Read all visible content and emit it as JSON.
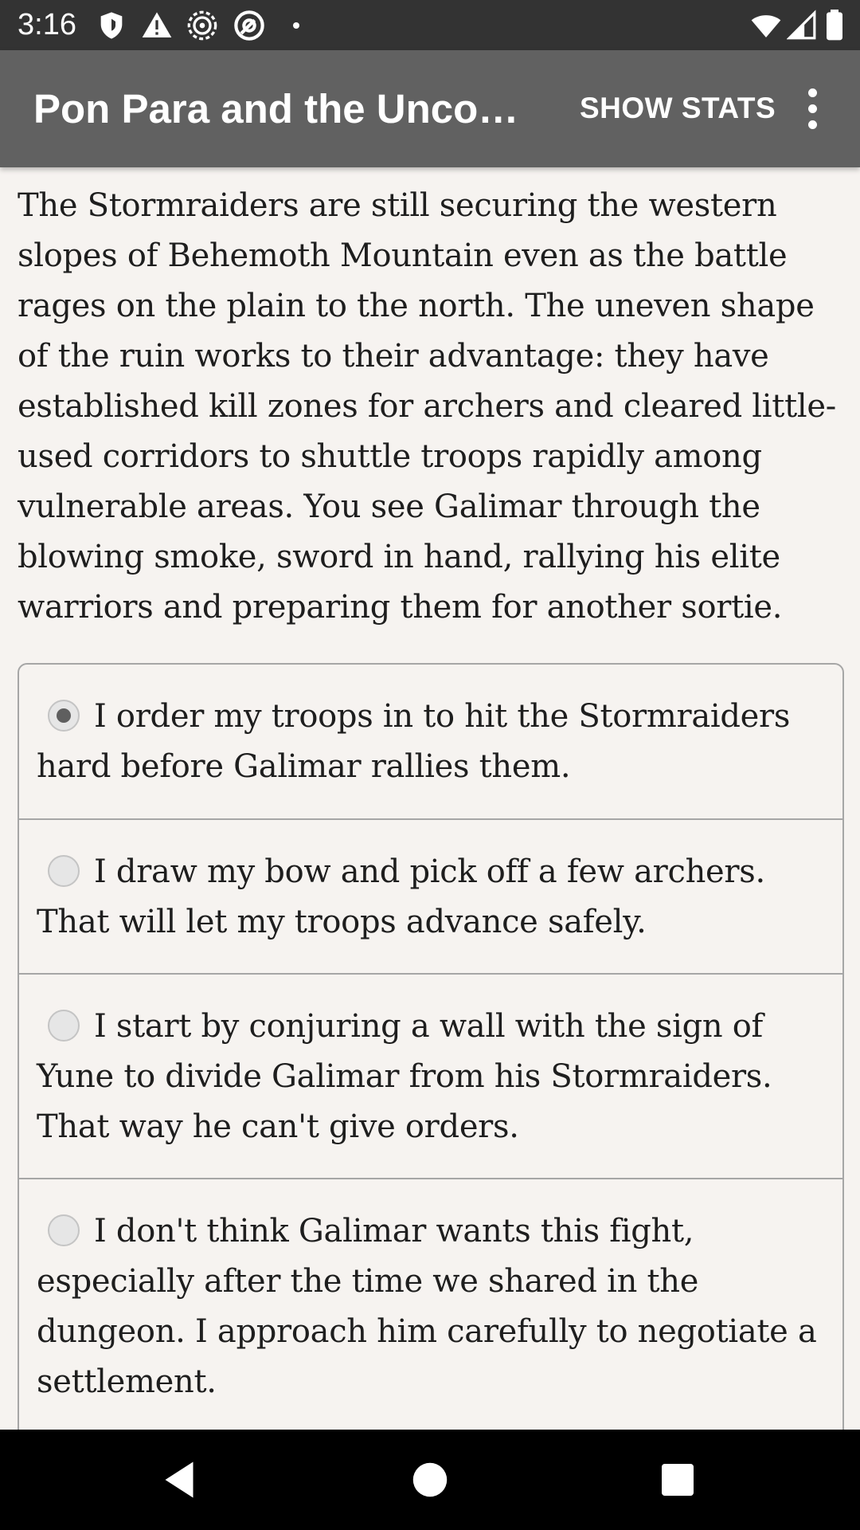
{
  "status_bar": {
    "time": "3:16",
    "icons": [
      "shield-icon",
      "warning-icon",
      "settings-badge-icon",
      "at-sign-icon",
      "dot-icon",
      "wifi-icon",
      "signal-icon",
      "battery-icon"
    ]
  },
  "app_bar": {
    "title": "Pon Para and the Unconquered Kings",
    "show_stats_label": "SHOW STATS",
    "menu_icon": "more-vert-icon",
    "background": "#616161"
  },
  "story": {
    "text": "The Stormraiders are still securing the western slopes of Behemoth Mountain even as the battle rages on the plain to the north. The uneven shape of the ruin works to their advantage: they have established kill zones for archers and cleared little-used corridors to shuttle troops rapidly among vulnerable areas. You see Galimar through the blowing smoke, sword in hand, rallying his elite warriors and preparing them for another sortie."
  },
  "choices": [
    {
      "label": "I order my troops in to hit the Stormraiders hard before Galimar rallies them.",
      "selected": true
    },
    {
      "label": "I draw my bow and pick off a few archers. That will let my troops advance safely.",
      "selected": false
    },
    {
      "label": "I start by conjuring a wall with the sign of Yune to divide Galimar from his Stormraiders. That way he can't give orders.",
      "selected": false
    },
    {
      "label": "I don't think Galimar wants this fight, especially after the time we shared in the dungeon. I approach him carefully to negotiate a settlement.",
      "selected": false
    }
  ],
  "nav_bar": {
    "icons": [
      "back-icon",
      "home-icon",
      "recents-icon"
    ]
  }
}
